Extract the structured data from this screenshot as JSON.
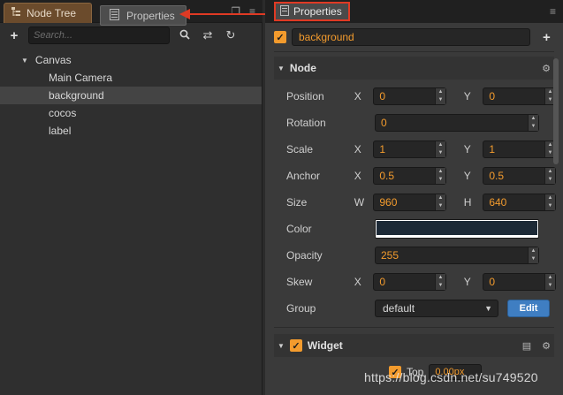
{
  "left_panel": {
    "tab_label": "Node Tree",
    "drag_tab_label": "Properties",
    "search_placeholder": "Search...",
    "tree": [
      {
        "label": "Canvas",
        "level": 0,
        "expanded": true
      },
      {
        "label": "Main Camera",
        "level": 1
      },
      {
        "label": "background",
        "level": 1,
        "selected": true
      },
      {
        "label": "cocos",
        "level": 1
      },
      {
        "label": "label",
        "level": 1
      }
    ]
  },
  "right_panel": {
    "tab_label": "Properties",
    "node_name": "background",
    "node_section": "Node",
    "props": {
      "position": {
        "label": "Position",
        "x_axis": "X",
        "x": "0",
        "y_axis": "Y",
        "y": "0"
      },
      "rotation": {
        "label": "Rotation",
        "value": "0"
      },
      "scale": {
        "label": "Scale",
        "x_axis": "X",
        "x": "1",
        "y_axis": "Y",
        "y": "1"
      },
      "anchor": {
        "label": "Anchor",
        "x_axis": "X",
        "x": "0.5",
        "y_axis": "Y",
        "y": "0.5"
      },
      "size": {
        "label": "Size",
        "w_axis": "W",
        "w": "960",
        "h_axis": "H",
        "h": "640"
      },
      "color": {
        "label": "Color",
        "value": "#1c2936"
      },
      "opacity": {
        "label": "Opacity",
        "value": "255"
      },
      "skew": {
        "label": "Skew",
        "x_axis": "X",
        "x": "0",
        "y_axis": "Y",
        "y": "0"
      },
      "group": {
        "label": "Group",
        "value": "default",
        "edit_label": "Edit"
      }
    },
    "widget": {
      "label": "Widget",
      "top_label": "Top",
      "top_value": "0.00px"
    }
  },
  "watermark": "https://blog.csdn.net/su749520",
  "colors": {
    "accent_orange": "#f39b2d",
    "highlight_red": "#e03a24",
    "edit_blue": "#3f7ec2",
    "tab_brown": "#6b4b2c"
  }
}
